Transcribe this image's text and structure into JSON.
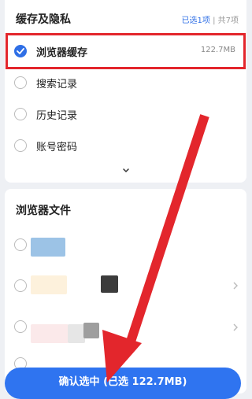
{
  "cache_section": {
    "title": "缓存及隐私",
    "selected_count": "已选1项",
    "separator": "|",
    "total_count": "共7项",
    "items": [
      {
        "label": "浏览器缓存",
        "size": "122.7MB",
        "checked": true
      },
      {
        "label": "搜索记录",
        "checked": false
      },
      {
        "label": "历史记录",
        "checked": false
      },
      {
        "label": "账号密码",
        "checked": false
      }
    ],
    "expand_icon": "chevron-down-icon"
  },
  "files_section": {
    "title": "浏览器文件"
  },
  "confirm_button": {
    "label": "确认选中 (已选 122.7MB)"
  },
  "colors": {
    "accent": "#2f6fe6",
    "button": "#2f74f0",
    "annotation_red": "#e3262c"
  }
}
